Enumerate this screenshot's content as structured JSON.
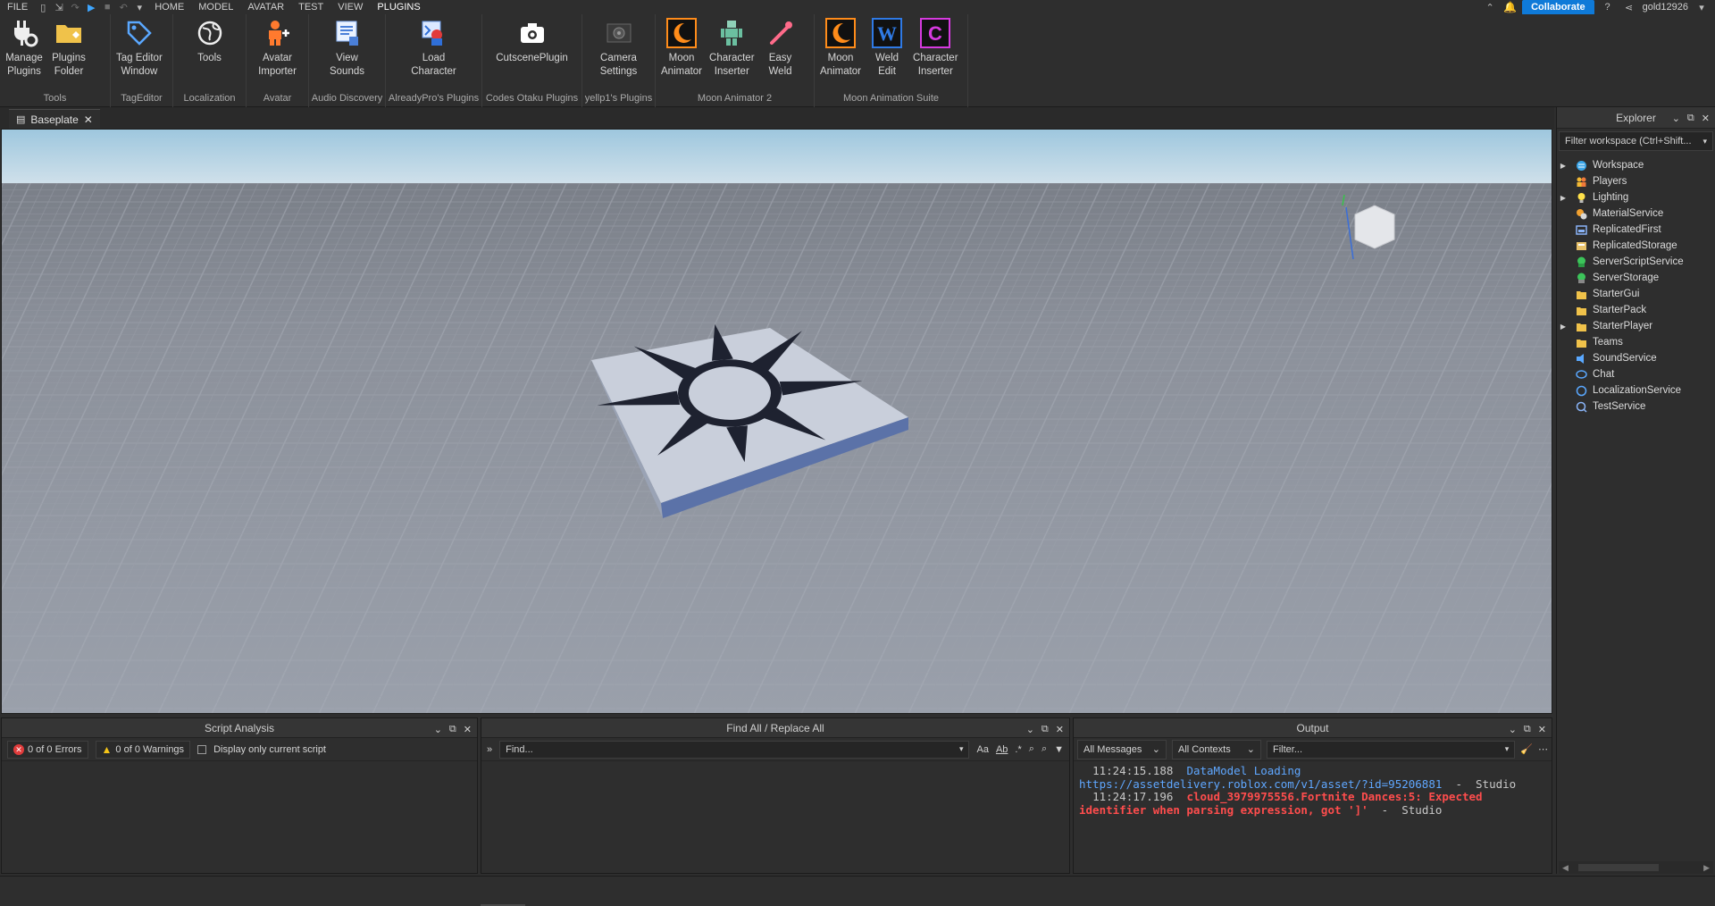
{
  "menu": {
    "items": [
      "FILE",
      "HOME",
      "MODEL",
      "AVATAR",
      "TEST",
      "VIEW",
      "PLUGINS"
    ],
    "active": "PLUGINS",
    "collaborate": "Collaborate",
    "username": "gold12926"
  },
  "ribbon": {
    "groups": [
      {
        "name": "Tools",
        "buttons": [
          {
            "label": "Manage\nPlugins",
            "icon": "plug-gear-icon"
          },
          {
            "label": "Plugins\nFolder",
            "icon": "folder-icon"
          }
        ]
      },
      {
        "name": "TagEditor",
        "buttons": [
          {
            "label": "Tag Editor\nWindow",
            "icon": "tag-icon"
          }
        ]
      },
      {
        "name": "Localization",
        "buttons": [
          {
            "label": "Tools",
            "icon": "globe-icon"
          }
        ]
      },
      {
        "name": "Avatar",
        "buttons": [
          {
            "label": "Avatar\nImporter",
            "icon": "avatar-importer-icon"
          }
        ]
      },
      {
        "name": "Audio Discovery",
        "buttons": [
          {
            "label": "View\nSounds",
            "icon": "sounds-icon"
          }
        ]
      },
      {
        "name": "AlreadyPro's Plugins",
        "buttons": [
          {
            "label": "Load\nCharacter",
            "icon": "load-character-icon"
          }
        ]
      },
      {
        "name": "Codes Otaku Plugins",
        "buttons": [
          {
            "label": "CutscenePlugin",
            "icon": "camera-icon"
          }
        ]
      },
      {
        "name": "yellp1's Plugins",
        "buttons": [
          {
            "label": "Camera\nSettings",
            "icon": "camera-settings-icon"
          }
        ]
      },
      {
        "name": "Moon Animator 2",
        "buttons": [
          {
            "label": "Moon\nAnimator",
            "icon": "moon-icon"
          },
          {
            "label": "Character\nInserter",
            "icon": "character-icon"
          },
          {
            "label": "Easy\nWeld",
            "icon": "weld-icon"
          }
        ]
      },
      {
        "name": "Moon Animation Suite",
        "buttons": [
          {
            "label": "Moon\nAnimator",
            "icon": "moon-icon"
          },
          {
            "label": "Weld\nEdit",
            "icon": "weld-edit-icon"
          },
          {
            "label": "Character\nInserter",
            "icon": "character-inserter-c-icon"
          }
        ]
      }
    ]
  },
  "doc_tab": {
    "label": "Baseplate"
  },
  "explorer": {
    "title": "Explorer",
    "filter_placeholder": "Filter workspace (Ctrl+Shift...",
    "nodes": [
      {
        "label": "Workspace",
        "expandable": true,
        "icon": "workspace-icon"
      },
      {
        "label": "Players",
        "expandable": false,
        "icon": "players-icon"
      },
      {
        "label": "Lighting",
        "expandable": true,
        "icon": "lighting-icon"
      },
      {
        "label": "MaterialService",
        "expandable": false,
        "icon": "material-service-icon"
      },
      {
        "label": "ReplicatedFirst",
        "expandable": false,
        "icon": "replicated-first-icon"
      },
      {
        "label": "ReplicatedStorage",
        "expandable": false,
        "icon": "replicated-storage-icon"
      },
      {
        "label": "ServerScriptService",
        "expandable": false,
        "icon": "server-script-service-icon"
      },
      {
        "label": "ServerStorage",
        "expandable": false,
        "icon": "server-storage-icon"
      },
      {
        "label": "StarterGui",
        "expandable": false,
        "icon": "starter-gui-icon"
      },
      {
        "label": "StarterPack",
        "expandable": false,
        "icon": "starter-pack-icon"
      },
      {
        "label": "StarterPlayer",
        "expandable": true,
        "icon": "starter-player-icon"
      },
      {
        "label": "Teams",
        "expandable": false,
        "icon": "teams-icon"
      },
      {
        "label": "SoundService",
        "expandable": false,
        "icon": "sound-service-icon"
      },
      {
        "label": "Chat",
        "expandable": false,
        "icon": "chat-icon"
      },
      {
        "label": "LocalizationService",
        "expandable": false,
        "icon": "localization-service-icon"
      },
      {
        "label": "TestService",
        "expandable": false,
        "icon": "test-service-icon"
      }
    ]
  },
  "script_analysis": {
    "title": "Script Analysis",
    "errors": "0 of 0 Errors",
    "warnings": "0 of 0 Warnings",
    "display_only": "Display only current script"
  },
  "find_all": {
    "title": "Find All / Replace All",
    "placeholder": "Find...",
    "opt_case": "Aa",
    "opt_word": "Ab",
    "opt_regex": ".*"
  },
  "output": {
    "title": "Output",
    "filter_messages": "All Messages",
    "filter_contexts": "All Contexts",
    "filter_placeholder": "Filter...",
    "lines": [
      {
        "time": "11:24:15.188",
        "message": "DataModel Loading https://assetdelivery.roblox.com/v1/asset/?id=95206881",
        "source": "Studio",
        "level": "info"
      },
      {
        "time": "11:24:17.196",
        "message": "cloud_3979975556.Fortnite Dances:5: Expected identifier when parsing expression, got ']'",
        "source": "Studio",
        "level": "error"
      }
    ]
  },
  "colors": {
    "accent": "#0f7ad8",
    "error": "#ff4d4d",
    "info": "#5fa7ff",
    "panel": "#2e2e2e"
  }
}
